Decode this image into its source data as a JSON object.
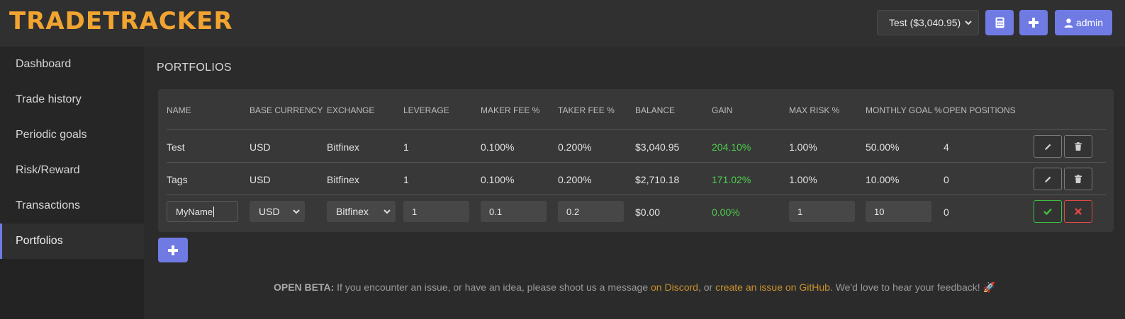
{
  "app": {
    "logo_text": "TRADETRACKER",
    "accent": "#6f7be3",
    "logo_color": "#f2a431"
  },
  "header": {
    "account_select": "Test ($3,040.95)",
    "calculator_icon": "calculator-icon",
    "add_icon": "plus-icon",
    "user_button_label": "admin",
    "user_icon": "user-icon"
  },
  "sidebar": {
    "items": [
      {
        "label": "Dashboard"
      },
      {
        "label": "Trade history"
      },
      {
        "label": "Periodic goals"
      },
      {
        "label": "Risk/Reward"
      },
      {
        "label": "Transactions"
      },
      {
        "label": "Portfolios",
        "active": true
      }
    ]
  },
  "main": {
    "title": "PORTFOLIOS",
    "columns": [
      "NAME",
      "BASE CURRENCY",
      "EXCHANGE",
      "LEVERAGE",
      "MAKER FEE %",
      "TAKER FEE %",
      "BALANCE",
      "GAIN",
      "MAX RISK %",
      "MONTHLY GOAL %",
      "OPEN POSITIONS"
    ],
    "rows": [
      {
        "name": "Test",
        "base_currency": "USD",
        "exchange": "Bitfinex",
        "leverage": "1",
        "maker_fee": "0.100%",
        "taker_fee": "0.200%",
        "balance": "$3,040.95",
        "gain": "204.10%",
        "max_risk": "1.00%",
        "monthly_goal": "50.00%",
        "open_positions": "4"
      },
      {
        "name": "Tags",
        "base_currency": "USD",
        "exchange": "Bitfinex",
        "leverage": "1",
        "maker_fee": "0.100%",
        "taker_fee": "0.200%",
        "balance": "$2,710.18",
        "gain": "171.02%",
        "max_risk": "1.00%",
        "monthly_goal": "10.00%",
        "open_positions": "0"
      }
    ],
    "edit_row": {
      "name": "MyName",
      "base_currency": "USD",
      "exchange": "Bitfinex",
      "leverage": "1",
      "maker_fee": "0.1",
      "taker_fee": "0.2",
      "balance": "$0.00",
      "gain": "0.00%",
      "max_risk": "1",
      "monthly_goal": "10",
      "open_positions": "0"
    },
    "gain_color": "#4cd04c"
  },
  "footer": {
    "bold": "OPEN BETA:",
    "text1": " If you encounter an issue, or have an idea, please shoot us a message ",
    "link1": "on Discord",
    "text2": ", or ",
    "link2": "create an issue on GitHub",
    "text3": ". We'd love to hear your feedback! ",
    "emoji": "🚀"
  }
}
